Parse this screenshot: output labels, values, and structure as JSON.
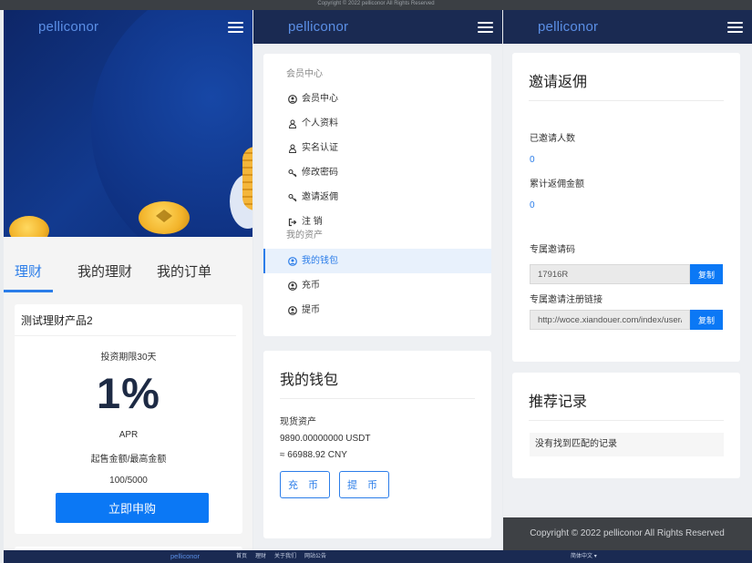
{
  "top_strip": {
    "text": "Copyright © 2022 pelliconor All Rights Reserved"
  },
  "brand": "pelliconor",
  "panel1": {
    "tabs": [
      "理财",
      "我的理财",
      "我的订单"
    ],
    "product": {
      "title": "测试理财产品2",
      "period": "投资期限30天",
      "rate": "1%",
      "rate_label": "APR",
      "amount_label": "起售金额/最高金额",
      "amount_range": "100/5000",
      "apply_label": "立即申购"
    }
  },
  "panel2": {
    "sections": [
      {
        "title": "会员中心",
        "items": [
          {
            "icon": "user-circle-icon",
            "label": "会员中心"
          },
          {
            "icon": "person-icon",
            "label": "个人资料"
          },
          {
            "icon": "person-icon",
            "label": "实名认证"
          },
          {
            "icon": "key-icon",
            "label": "修改密码"
          },
          {
            "icon": "key-icon",
            "label": "邀请返佣"
          },
          {
            "icon": "logout-icon",
            "label": "注 销"
          }
        ]
      },
      {
        "title": "我的资产",
        "items": [
          {
            "icon": "user-circle-icon",
            "label": "我的钱包",
            "active": true
          },
          {
            "icon": "user-circle-icon",
            "label": "充币"
          },
          {
            "icon": "user-circle-icon",
            "label": "提币"
          }
        ]
      }
    ],
    "wallet": {
      "title": "我的钱包",
      "assets_label": "现货资产",
      "usdt": "9890.00000000 USDT",
      "cny": "≈ 66988.92 CNY",
      "deposit_label": "充 币",
      "withdraw_label": "提 币"
    }
  },
  "panel3": {
    "invite": {
      "title": "邀请返佣",
      "invited_label": "已邀请人数",
      "invited_count": "0",
      "rebate_label": "累计返佣金额",
      "rebate_amount": "0",
      "code_label": "专属邀请码",
      "code_value": "17916R",
      "link_label": "专属邀请注册链接",
      "link_value": "http://woce.xiandouer.com/index/user/reg",
      "copy_label": "复制"
    },
    "records": {
      "title": "推荐记录",
      "empty": "没有找到匹配的记录"
    },
    "footer": "Copyright © 2022 pelliconor All Rights Reserved"
  },
  "bottom_bar": {
    "brand": "pelliconor",
    "links": [
      "首页",
      "理财",
      "关于我们",
      "网站公告"
    ],
    "language": "简体中文"
  },
  "colors": {
    "accent": "#2b7de9",
    "primary_button": "#0b78f5",
    "navbar": "#1a2a52",
    "brand_text": "#5b8fe6"
  }
}
